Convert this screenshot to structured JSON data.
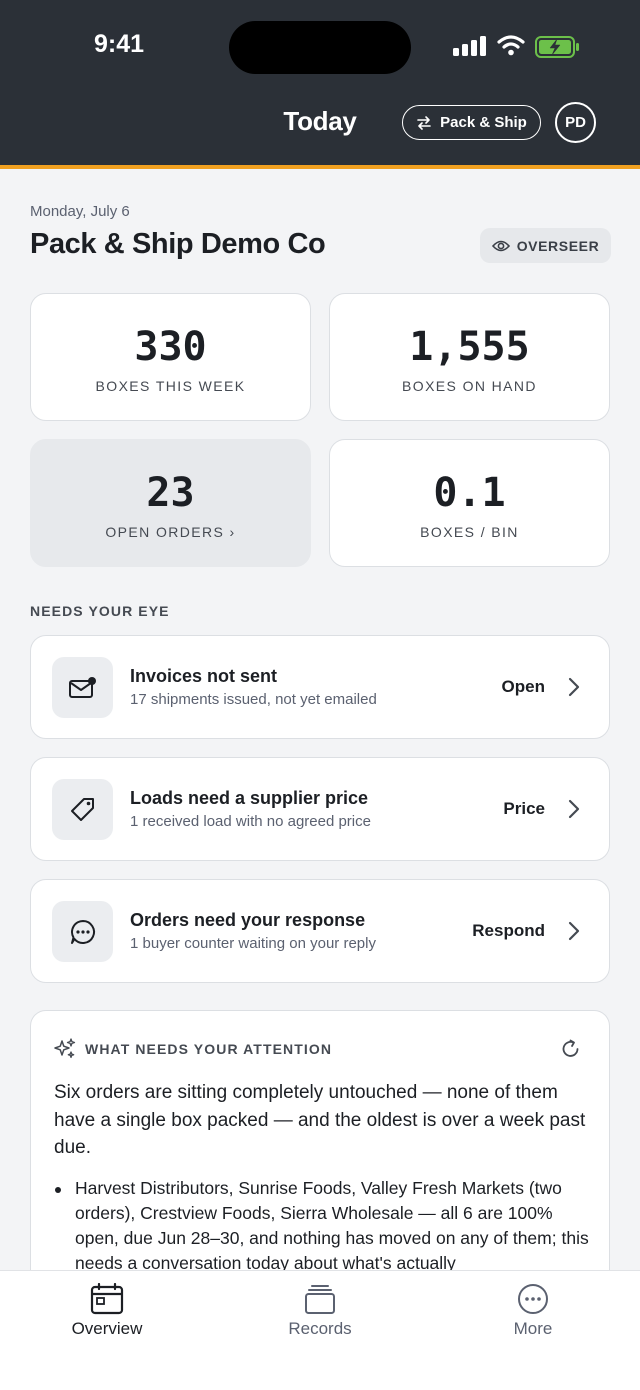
{
  "status_bar": {
    "time": "9:41"
  },
  "header": {
    "title": "Today",
    "mode_button": "Pack & Ship",
    "avatar_initials": "PD",
    "accent_color": "#f0a020"
  },
  "page": {
    "date": "Monday, July 6",
    "company": "Pack & Ship Demo Co",
    "role_badge": "OVERSEER"
  },
  "stats": [
    {
      "value": "330",
      "label": "BOXES THIS WEEK"
    },
    {
      "value": "1,555",
      "label": "BOXES ON HAND"
    },
    {
      "value": "23",
      "label": "OPEN ORDERS ›"
    },
    {
      "value": "0.1",
      "label": "BOXES / BIN"
    }
  ],
  "needs_your_eye": {
    "title": "NEEDS YOUR EYE",
    "items": [
      {
        "icon": "mail-icon",
        "title": "Invoices not sent",
        "subtitle": "17 shipments issued, not yet emailed",
        "action": "Open"
      },
      {
        "icon": "tag-icon",
        "title": "Loads need a supplier price",
        "subtitle": "1 received load with no agreed price",
        "action": "Price"
      },
      {
        "icon": "chat-icon",
        "title": "Orders need your response",
        "subtitle": "1 buyer counter waiting on your reply",
        "action": "Respond"
      }
    ]
  },
  "attention": {
    "title": "WHAT NEEDS YOUR ATTENTION",
    "summary": "Six orders are sitting completely untouched — none of them have a single box packed — and the oldest is over a week past due.",
    "bullet": "Harvest Distributors, Sunrise Foods, Valley Fresh Markets (two orders), Crestview Foods, Sierra Wholesale — all 6 are 100% open, due Jun 28–30, and nothing has moved on any of them; this needs a conversation today about what's actually"
  },
  "bottom_nav": [
    {
      "label": "Overview",
      "icon": "calendar-icon"
    },
    {
      "label": "Records",
      "icon": "stack-icon"
    },
    {
      "label": "More",
      "icon": "more-icon"
    }
  ]
}
